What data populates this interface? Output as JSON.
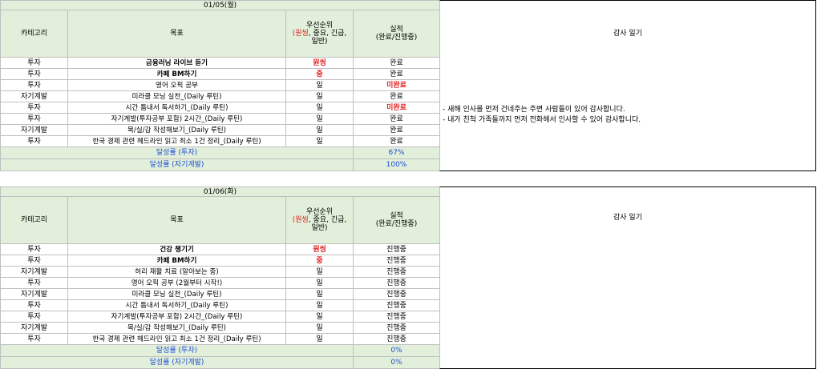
{
  "days": [
    {
      "date": "01/05(월)",
      "headers": {
        "category": "카테고리",
        "goal": "목표",
        "priority_title": "우선순위",
        "priority_red": "(원씽",
        "priority_rest": ", 중요, 긴급,",
        "priority_line3": "일반)",
        "result_title": "실적",
        "result_sub": "(완료/진행중)",
        "diary": "감사 일기"
      },
      "rows": [
        {
          "category": "투자",
          "goal": "금융러닝 라이브 듣기",
          "priority": "원씽",
          "result": "완료"
        },
        {
          "category": "투자",
          "goal": "카페 BM하기",
          "priority": "중",
          "result": "완료"
        },
        {
          "category": "투자",
          "goal": "영어 오픽 공부",
          "priority": "일",
          "result": "미완료"
        },
        {
          "category": "자기계발",
          "goal": "미라클 모닝 실천_(Daily 루틴)",
          "priority": "일",
          "result": "완료"
        },
        {
          "category": "투자",
          "goal": "시간 틈내서 독서하기_(Daily 루틴)",
          "priority": "일",
          "result": "미완료"
        },
        {
          "category": "투자",
          "goal": "자기계발(투자공부 포함) 2시간_(Daily 루틴)",
          "priority": "일",
          "result": "완료"
        },
        {
          "category": "자기계발",
          "goal": "목/실/감 작성해보기_(Daily 루틴)",
          "priority": "일",
          "result": "완료"
        },
        {
          "category": "투자",
          "goal": "한국 경제 관련 헤드라인 읽고 최소 1건 정리_(Daily 루틴)",
          "priority": "일",
          "result": "완료"
        }
      ],
      "achievements": [
        {
          "label": "달성률 (투자)",
          "value": "67%"
        },
        {
          "label": "달성률 (자기계발)",
          "value": "100%"
        }
      ],
      "diary_lines": [
        "- 새해 인사를 먼저 건네주는 주변 사람들이 있어 감사합니다.",
        "- 내가 친척 가족들까지 먼저 전화해서 인사할 수 있어 감사합니다."
      ]
    },
    {
      "date": "01/06(화)",
      "headers": {
        "category": "카테고리",
        "goal": "목표",
        "priority_title": "우선순위",
        "priority_red": "(원씽",
        "priority_rest": ", 중요, 긴급,",
        "priority_line3": "일반)",
        "result_title": "실적",
        "result_sub": "(완료/진행중)",
        "diary": "감사 일기"
      },
      "rows": [
        {
          "category": "투자",
          "goal": "건강 챙기기",
          "priority": "원씽",
          "result": "진행중"
        },
        {
          "category": "투자",
          "goal": "카페 BM하기",
          "priority": "중",
          "result": "진행중"
        },
        {
          "category": "자기계발",
          "goal": "허리 재활 치료 (알아보는 중)",
          "priority": "일",
          "result": "진행중"
        },
        {
          "category": "투자",
          "goal": "영어 오픽 공부 (2월부터 시작!)",
          "priority": "일",
          "result": "진행중"
        },
        {
          "category": "자기계발",
          "goal": "미라클 모닝 실천_(Daily 루틴)",
          "priority": "일",
          "result": "진행중"
        },
        {
          "category": "투자",
          "goal": "시간 틈내서 독서하기_(Daily 루틴)",
          "priority": "일",
          "result": "진행중"
        },
        {
          "category": "투자",
          "goal": "자기계발(투자공부 포함) 2시간_(Daily 루틴)",
          "priority": "일",
          "result": "진행중"
        },
        {
          "category": "자기계발",
          "goal": "목/실/감 작성해보기_(Daily 루틴)",
          "priority": "일",
          "result": "진행중"
        },
        {
          "category": "투자",
          "goal": "한국 경제 관련 헤드라인 읽고 최소 1건 정리_(Daily 루틴)",
          "priority": "일",
          "result": "진행중"
        }
      ],
      "achievements": [
        {
          "label": "달성률 (투자)",
          "value": "0%"
        },
        {
          "label": "달성률 (자기계발)",
          "value": "0%"
        }
      ],
      "diary_lines": []
    }
  ],
  "colors": {
    "header_bg": "#e2efda",
    "accent_red": "#e02020",
    "achievement_blue": "#1f4fd8",
    "grid_line": "#bfbfbf"
  }
}
